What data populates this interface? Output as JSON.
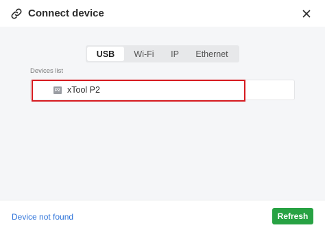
{
  "dialog": {
    "title": "Connect device",
    "title_icon": "link-icon",
    "close_icon": "close-icon"
  },
  "tabs": [
    {
      "label": "USB",
      "active": true
    },
    {
      "label": "Wi-Fi",
      "active": false
    },
    {
      "label": "IP",
      "active": false
    },
    {
      "label": "Ethernet",
      "active": false
    }
  ],
  "devices": {
    "label": "Devices list",
    "items": [
      {
        "chip": "P2",
        "name": "xTool P2",
        "highlighted": true
      }
    ]
  },
  "footer": {
    "not_found_label": "Device not found",
    "refresh_label": "Refresh"
  },
  "colors": {
    "accent_green": "#27a243",
    "link_blue": "#2e73d9",
    "highlight_red": "#d61a1f"
  }
}
